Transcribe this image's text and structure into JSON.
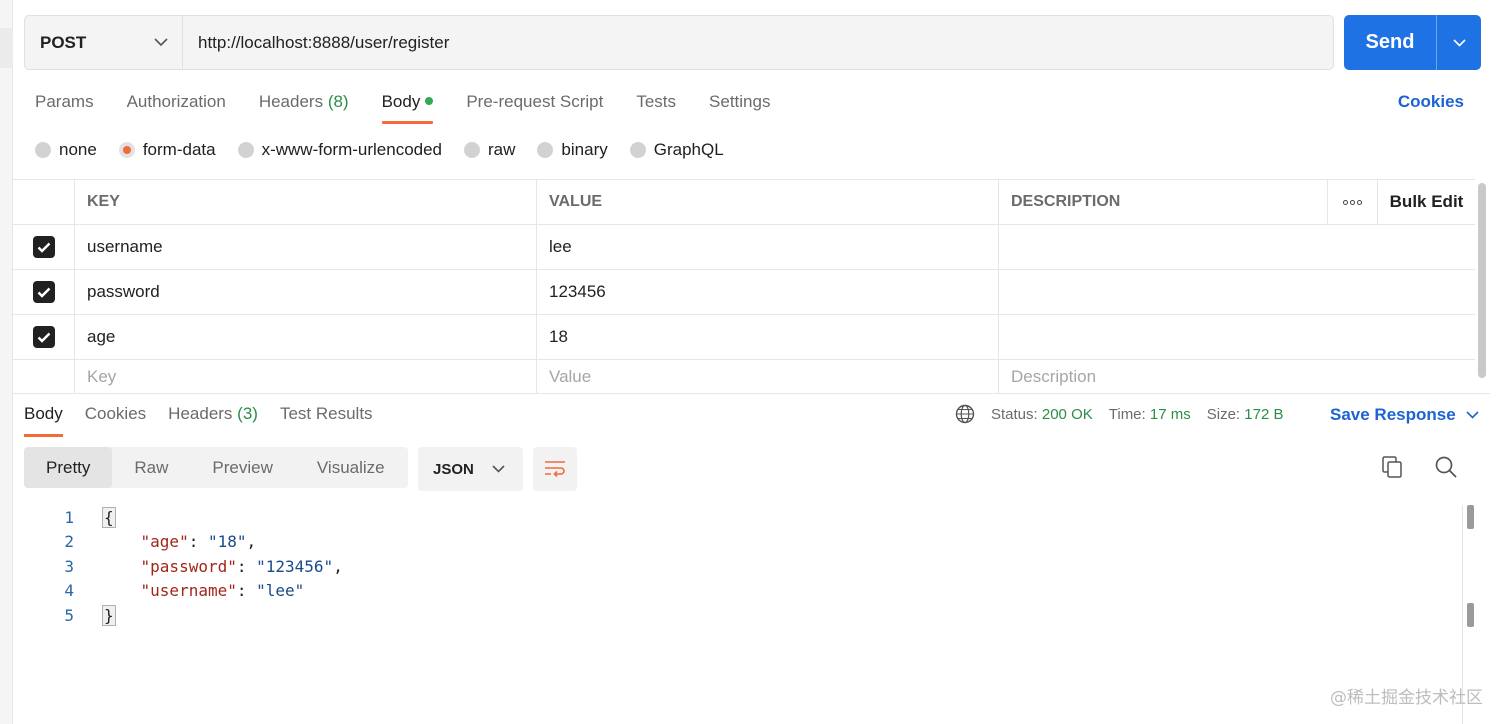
{
  "request": {
    "method": "POST",
    "url": "http://localhost:8888/user/register",
    "send_label": "Send"
  },
  "request_tabs": [
    {
      "label": "Params",
      "count": ""
    },
    {
      "label": "Authorization",
      "count": ""
    },
    {
      "label": "Headers",
      "count": "(8)"
    },
    {
      "label": "Body",
      "count": ""
    },
    {
      "label": "Pre-request Script",
      "count": ""
    },
    {
      "label": "Tests",
      "count": ""
    },
    {
      "label": "Settings",
      "count": ""
    }
  ],
  "active_request_tab": "Body",
  "cookies_label": "Cookies",
  "body_types": [
    "none",
    "form-data",
    "x-www-form-urlencoded",
    "raw",
    "binary",
    "GraphQL"
  ],
  "selected_body_type": "form-data",
  "table": {
    "headers": {
      "key": "KEY",
      "value": "VALUE",
      "description": "DESCRIPTION",
      "bulk_edit": "Bulk Edit"
    },
    "rows": [
      {
        "checked": true,
        "key": "username",
        "value": "lee",
        "description": ""
      },
      {
        "checked": true,
        "key": "password",
        "value": "123456",
        "description": ""
      },
      {
        "checked": true,
        "key": "age",
        "value": "18",
        "description": ""
      }
    ],
    "placeholders": {
      "key": "Key",
      "value": "Value",
      "description": "Description"
    }
  },
  "response": {
    "tabs": [
      {
        "label": "Body",
        "count": ""
      },
      {
        "label": "Cookies",
        "count": ""
      },
      {
        "label": "Headers",
        "count": "(3)"
      },
      {
        "label": "Test Results",
        "count": ""
      }
    ],
    "status_label": "Status:",
    "status_value": "200 OK",
    "time_label": "Time:",
    "time_value": "17 ms",
    "size_label": "Size:",
    "size_value": "172 B",
    "save_label": "Save Response",
    "views": [
      "Pretty",
      "Raw",
      "Preview",
      "Visualize"
    ],
    "active_view": "Pretty",
    "format": "JSON",
    "code_lines": [
      {
        "n": "1",
        "text": "{"
      },
      {
        "n": "2",
        "key": "\"age\"",
        "value": "\"18\"",
        "trail": ","
      },
      {
        "n": "3",
        "key": "\"password\"",
        "value": "\"123456\"",
        "trail": ","
      },
      {
        "n": "4",
        "key": "\"username\"",
        "value": "\"lee\"",
        "trail": ""
      },
      {
        "n": "5",
        "text": "}"
      }
    ]
  },
  "watermark": "@稀土掘金技术社区",
  "colors": {
    "accent": "#f26b3a",
    "send": "#1e72e4",
    "link": "#1d63d1",
    "ok": "#2a8f47"
  }
}
